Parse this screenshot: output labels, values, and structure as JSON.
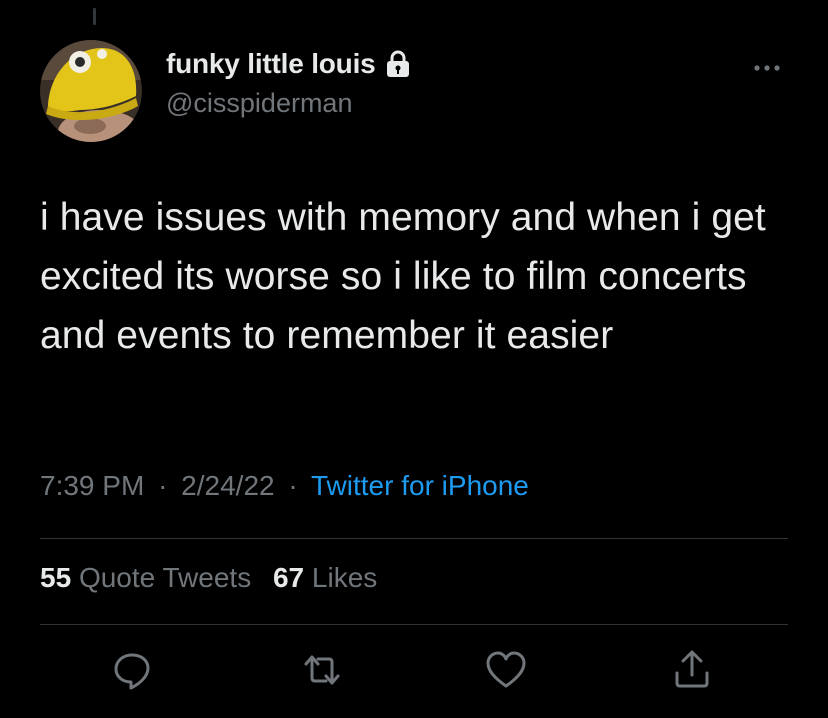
{
  "author": {
    "display_name": "funky little louis",
    "handle": "@cisspiderman",
    "protected": true
  },
  "tweet": {
    "text": "i have issues with memory and when i get excited its worse so i like to film concerts and events to remember it easier",
    "time": "7:39 PM",
    "date": "2/24/22",
    "separator": "·",
    "source": "Twitter for iPhone"
  },
  "stats": {
    "quote_tweets_count": "55",
    "quote_tweets_label": "Quote Tweets",
    "likes_count": "67",
    "likes_label": "Likes"
  },
  "icons": {
    "lock": "lock-icon",
    "more": "more-icon",
    "reply": "reply-icon",
    "retweet": "retweet-icon",
    "like": "heart-icon",
    "share": "share-icon"
  },
  "colors": {
    "background": "#000000",
    "text": "#e7e9ea",
    "secondary": "#71767b",
    "accent": "#1d9bf0",
    "divider": "#2f3336"
  }
}
